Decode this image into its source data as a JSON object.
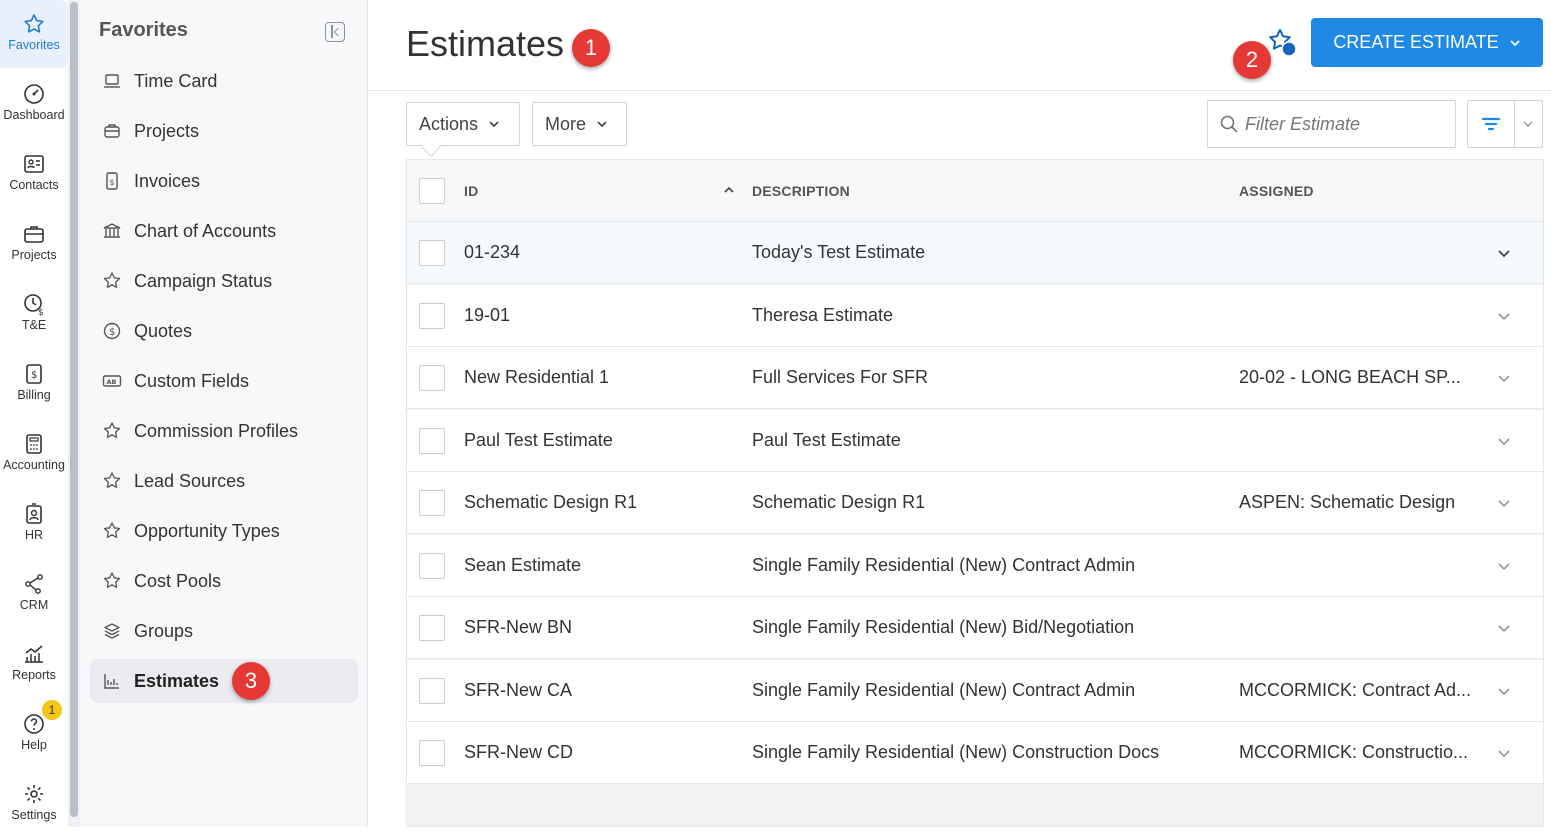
{
  "rail": {
    "items": [
      {
        "label": "Favorites",
        "icon": "star-icon",
        "active": true
      },
      {
        "label": "Dashboard",
        "icon": "gauge-icon"
      },
      {
        "label": "Contacts",
        "icon": "contact-card-icon"
      },
      {
        "label": "Projects",
        "icon": "briefcase-icon"
      },
      {
        "label": "T&E",
        "icon": "clock-dollar-icon"
      },
      {
        "label": "Billing",
        "icon": "invoice-icon"
      },
      {
        "label": "Accounting",
        "icon": "calculator-icon"
      },
      {
        "label": "HR",
        "icon": "badge-person-icon"
      },
      {
        "label": "CRM",
        "icon": "network-icon"
      },
      {
        "label": "Reports",
        "icon": "chart-icon"
      },
      {
        "label": "Help",
        "icon": "help-icon",
        "badge": "1"
      },
      {
        "label": "Settings",
        "icon": "gear-icon"
      }
    ]
  },
  "favorites": {
    "title": "Favorites",
    "items": [
      {
        "label": "Time Card",
        "icon": "laptop-icon"
      },
      {
        "label": "Projects",
        "icon": "briefcase-icon"
      },
      {
        "label": "Invoices",
        "icon": "invoice-icon"
      },
      {
        "label": "Chart of Accounts",
        "icon": "bank-icon"
      },
      {
        "label": "Campaign Status",
        "icon": "star-icon"
      },
      {
        "label": "Quotes",
        "icon": "dollar-circle-icon"
      },
      {
        "label": "Custom Fields",
        "icon": "ab-field-icon"
      },
      {
        "label": "Commission Profiles",
        "icon": "star-icon"
      },
      {
        "label": "Lead Sources",
        "icon": "star-icon"
      },
      {
        "label": "Opportunity Types",
        "icon": "star-icon"
      },
      {
        "label": "Cost Pools",
        "icon": "star-icon"
      },
      {
        "label": "Groups",
        "icon": "layers-icon"
      },
      {
        "label": "Estimates",
        "icon": "chart-icon",
        "active": true
      }
    ]
  },
  "markers": [
    "1",
    "2",
    "3"
  ],
  "header": {
    "title": "Estimates",
    "create_label": "CREATE ESTIMATE"
  },
  "toolbar": {
    "actions_label": "Actions",
    "more_label": "More",
    "filter_placeholder": "Filter Estimate"
  },
  "table": {
    "columns": {
      "id": "ID",
      "description": "DESCRIPTION",
      "assigned": "ASSIGNED"
    },
    "rows": [
      {
        "id": "01-234",
        "description": "Today's Test Estimate",
        "assigned": ""
      },
      {
        "id": "19-01",
        "description": "Theresa Estimate",
        "assigned": ""
      },
      {
        "id": "New Residential 1",
        "description": "Full Services For SFR",
        "assigned": "20-02 - LONG BEACH SP..."
      },
      {
        "id": "Paul Test Estimate",
        "description": "Paul Test Estimate",
        "assigned": ""
      },
      {
        "id": "Schematic Design R1",
        "description": "Schematic Design R1",
        "assigned": "ASPEN: Schematic Design"
      },
      {
        "id": "Sean Estimate",
        "description": "Single Family Residential (New) Contract Admin",
        "assigned": ""
      },
      {
        "id": "SFR-New BN",
        "description": "Single Family Residential (New) Bid/Negotiation",
        "assigned": ""
      },
      {
        "id": "SFR-New CA",
        "description": "Single Family Residential (New) Contract Admin",
        "assigned": "MCCORMICK: Contract Ad..."
      },
      {
        "id": "SFR-New CD",
        "description": "Single Family Residential (New) Construction Docs",
        "assigned": "MCCORMICK: Constructio..."
      }
    ]
  },
  "colors": {
    "accent": "#1f8ae6",
    "marker": "#e53935",
    "badge": "#f5c518"
  }
}
